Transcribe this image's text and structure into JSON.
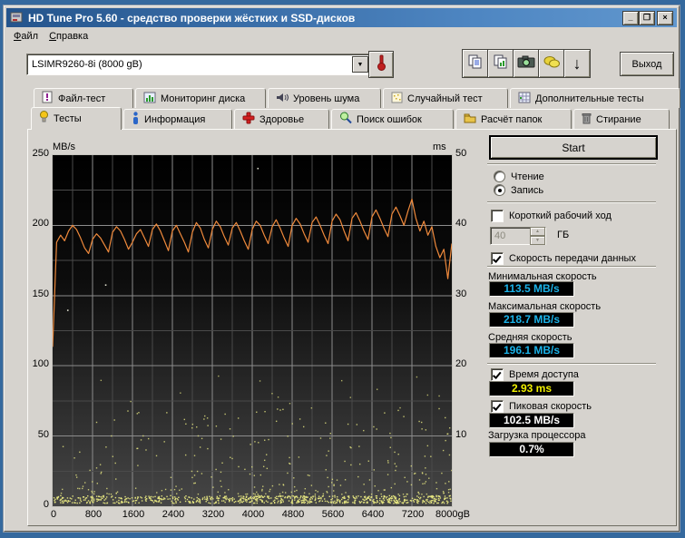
{
  "window": {
    "title": "HD Tune Pro 5.60 - средство проверки жёстких и SSD-дисков",
    "minimize_glyph": "_",
    "maximize_glyph": "❐",
    "close_glyph": "×"
  },
  "menu": {
    "file": {
      "accel": "Ф",
      "rest": "айл"
    },
    "help": {
      "accel": "С",
      "rest": "правка"
    }
  },
  "toolbar": {
    "drive_selected": "LSIMR9260-8i (8000 gB)",
    "exit_label": "Выход",
    "down_arrow_glyph": "↓"
  },
  "tabs": {
    "row1": [
      {
        "label": "Файл-тест"
      },
      {
        "label": "Мониторинг диска"
      },
      {
        "label": "Уровень шума"
      },
      {
        "label": "Случайный тест"
      },
      {
        "label": "Дополнительные тесты"
      }
    ],
    "row2": [
      {
        "label": "Тесты"
      },
      {
        "label": "Информация"
      },
      {
        "label": "Здоровье"
      },
      {
        "label": "Поиск ошибок"
      },
      {
        "label": "Расчёт папок"
      },
      {
        "label": "Стирание"
      }
    ],
    "active": "Тесты"
  },
  "controls": {
    "start_label": "Start",
    "read_label": "Чтение",
    "write_label": "Запись",
    "short_stroke_label": "Короткий рабочий ход",
    "capacity_value": "40",
    "capacity_unit": "ГБ",
    "transfer_label": "Скорость передачи данных",
    "min_label": "Минимальная скорость",
    "min_value": "113.5 MB/s",
    "max_label": "Максимальная скорость",
    "max_value": "218.7 MB/s",
    "avg_label": "Средняя скорость",
    "avg_value": "196.1 MB/s",
    "access_label": "Время доступа",
    "access_value": "2.93 ms",
    "burst_label": "Пиковая скорость",
    "burst_value": "102.5 MB/s",
    "cpu_label": "Загрузка процессора",
    "cpu_value": "0.7%"
  },
  "colors": {
    "speed_value": "#1ab2e8",
    "access_value": "#f0f000",
    "burst_value": "#ffffff",
    "cpu_value": "#ffffff",
    "line": "#f08a3c",
    "dots": "#e9e982",
    "grid_major": "#8c8c8c",
    "grid_minor": "#4a4a4a",
    "titlebar_left": "#24548c",
    "titlebar_right": "#6197ce"
  },
  "chart_data": {
    "type": "line+scatter",
    "x_axis": {
      "unit": "gB",
      "range": [
        0,
        8000
      ],
      "major_step": 800,
      "minor_step": 400,
      "major_tick_labels": [
        "0",
        "800",
        "1600",
        "2400",
        "3200",
        "4000",
        "4800",
        "5600",
        "6400",
        "7200",
        "8000gB"
      ]
    },
    "left_axis": {
      "label": "MB/s",
      "range": [
        0,
        250
      ],
      "major_step": 50,
      "minor_step": 25,
      "tick_labels": [
        "250",
        "200",
        "150",
        "100",
        "50",
        "0"
      ],
      "tick_values": [
        250,
        200,
        150,
        100,
        50,
        0
      ]
    },
    "right_axis": {
      "label": "ms",
      "range": [
        0,
        50
      ],
      "tick_labels": [
        "50",
        "40",
        "30",
        "20",
        "10"
      ],
      "tick_values_left_units": [
        250,
        200,
        150,
        100,
        50
      ]
    },
    "series": [
      {
        "name": "write-transfer-rate",
        "type": "line",
        "unit": "MB/s",
        "color": "#f08a3c",
        "x_step_gB": 80,
        "values": [
          113.5,
          188,
          193,
          189,
          196,
          200,
          197,
          191,
          184,
          180,
          190,
          194,
          191,
          186,
          181,
          195,
          199,
          196,
          190,
          183,
          188,
          194,
          197,
          191,
          185,
          197,
          201,
          196,
          189,
          182,
          196,
          200,
          194,
          188,
          181,
          195,
          202,
          198,
          190,
          184,
          197,
          203,
          199,
          192,
          186,
          198,
          202,
          196,
          189,
          183,
          197,
          203,
          200,
          193,
          187,
          199,
          204,
          198,
          191,
          185,
          200,
          205,
          201,
          194,
          188,
          202,
          206,
          200,
          193,
          187,
          203,
          208,
          204,
          196,
          189,
          205,
          209,
          203,
          196,
          190,
          206,
          211,
          205,
          198,
          192,
          208,
          213,
          207,
          200,
          210,
          218.7,
          205,
          196,
          203,
          193,
          199,
          185,
          177,
          183,
          162,
          187
        ]
      },
      {
        "name": "access-time-dots",
        "type": "scatter",
        "unit": "ms",
        "color": "#e9e982",
        "seed": 97531,
        "band": {
          "count": 760,
          "y_min_units": 2.5,
          "y_max_units": 8
        },
        "mid": {
          "count": 280,
          "y_min_units": 9,
          "y_max_units": 70
        },
        "high": {
          "count": 16,
          "y_min_units": 70,
          "y_max_units": 95
        },
        "stray_dots_units": [
          [
            4100,
            241
          ],
          [
            1050,
            158
          ],
          [
            290,
            140
          ]
        ]
      }
    ],
    "summary": {
      "min": "113.5 MB/s",
      "max": "218.7 MB/s",
      "avg": "196.1 MB/s",
      "access": "2.93 ms",
      "burst": "102.5 MB/s",
      "cpu": "0.7%"
    }
  }
}
